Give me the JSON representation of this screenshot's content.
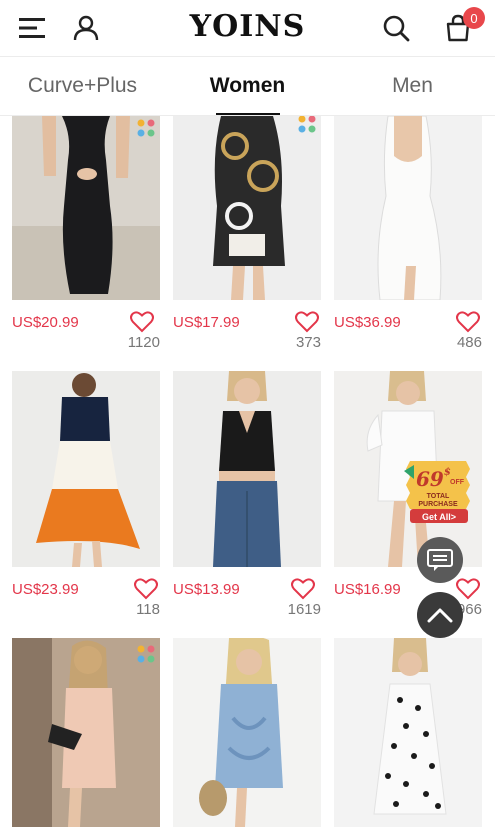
{
  "header": {
    "logo": "YOINS",
    "cart_count": "0"
  },
  "tabs": [
    {
      "label": "Curve+Plus",
      "active": false
    },
    {
      "label": "Women",
      "active": true
    },
    {
      "label": "Men",
      "active": false
    }
  ],
  "products": [
    {
      "price": "US$20.99",
      "likes": "1120"
    },
    {
      "price": "US$17.99",
      "likes": "373"
    },
    {
      "price": "US$36.99",
      "likes": "486"
    },
    {
      "price": "US$23.99",
      "likes": "118"
    },
    {
      "price": "US$13.99",
      "likes": "1619"
    },
    {
      "price": "US$16.99",
      "likes": "966"
    },
    {
      "price": "",
      "likes": ""
    },
    {
      "price": "",
      "likes": ""
    },
    {
      "price": "",
      "likes": ""
    }
  ],
  "promo": {
    "amount": "69",
    "currency": "$",
    "off": "OFF",
    "line1": "TOTAL",
    "line2": "PURCHASE",
    "cta": "Get All>"
  },
  "colors": {
    "price": "#e3364a",
    "badge": "#e8474b"
  }
}
